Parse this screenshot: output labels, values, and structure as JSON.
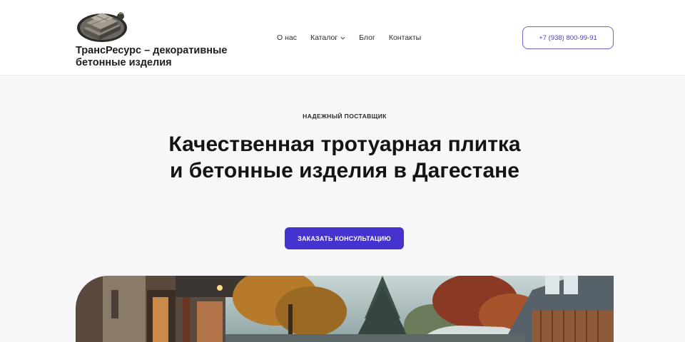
{
  "header": {
    "brand_name": "ТрансРесурс – декоративные бетонные изделия",
    "phone": "+7 (938) 800-99-91"
  },
  "nav": {
    "items": [
      {
        "label": "О нас"
      },
      {
        "label": "Каталог",
        "has_dropdown": true
      },
      {
        "label": "Блог"
      },
      {
        "label": "Контакты"
      }
    ]
  },
  "hero": {
    "eyebrow": "НАДЕЖНЫЙ ПОСТАВЩИК",
    "title": "Качественная тротуарная плитка и бетонные изделия в Дагестане",
    "cta_label": "ЗАКАЗАТЬ КОНСУЛЬТАЦИЮ"
  },
  "colors": {
    "accent": "#4433cf",
    "accent_outline": "#6f63d8",
    "text": "#1d1d22",
    "background": "#f7f7f9"
  },
  "icons": {
    "logo": "stacked-pavers-logo-icon",
    "dropdown": "chevron-down-icon"
  }
}
